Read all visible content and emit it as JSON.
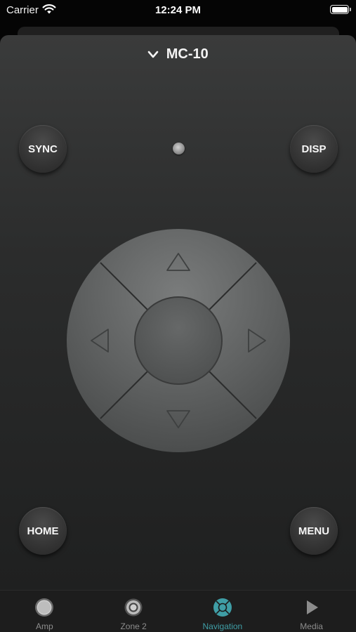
{
  "status_bar": {
    "carrier": "Carrier",
    "time": "12:24 PM"
  },
  "device": {
    "name": "MC-10"
  },
  "buttons": {
    "sync": "SYNC",
    "disp": "DISP",
    "home": "HOME",
    "menu": "MENU"
  },
  "tabs": [
    {
      "label": "Amp",
      "icon": "amp-knob-icon",
      "active": false
    },
    {
      "label": "Zone 2",
      "icon": "zone-icon",
      "active": false
    },
    {
      "label": "Navigation",
      "icon": "navigation-icon",
      "active": true
    },
    {
      "label": "Media",
      "icon": "play-icon",
      "active": false
    }
  ],
  "colors": {
    "accent": "#3f9ea6",
    "inactive": "#8c8c8c"
  }
}
